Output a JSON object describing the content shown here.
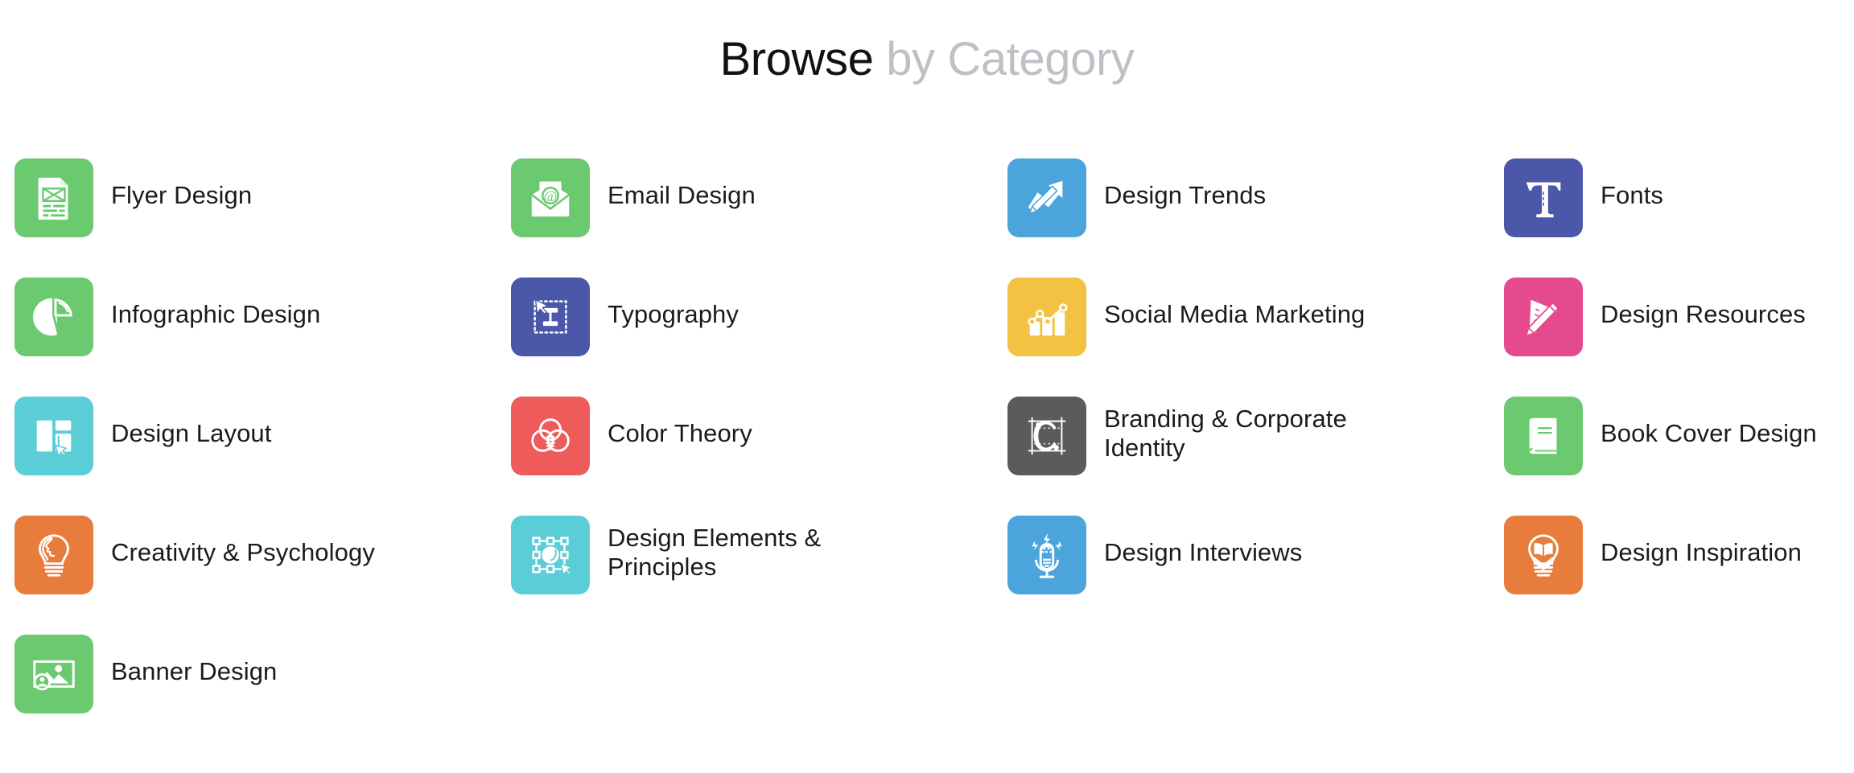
{
  "heading": {
    "strong": "Browse",
    "light": " by Category"
  },
  "colors": {
    "green": "#6BC96F",
    "blue": "#4BA5DC",
    "indigo": "#4B57A8",
    "amber": "#F3C243",
    "pink": "#E5498E",
    "cyan": "#5ACDD7",
    "red": "#EE5B5B",
    "darkgray": "#5B5B5B",
    "orange": "#E87C3C",
    "text_dark": "#1b1b1b",
    "text_light": "#bdc1c6",
    "background": "#ffffff"
  },
  "categories": [
    {
      "label": "Flyer Design",
      "icon": "flyer-document-icon",
      "color": "#6BC96F",
      "two_line": false
    },
    {
      "label": "Email Design",
      "icon": "envelope-at-icon",
      "color": "#6BC96F",
      "two_line": false
    },
    {
      "label": "Design Trends",
      "icon": "trend-arrow-pencil-icon",
      "color": "#4BA5DC",
      "two_line": false
    },
    {
      "label": "Fonts",
      "icon": "serif-t-icon",
      "color": "#4B57A8",
      "two_line": false
    },
    {
      "label": "Infographic Design",
      "icon": "pie-chart-icon",
      "color": "#6BC96F",
      "two_line": false
    },
    {
      "label": "Typography",
      "icon": "text-cursor-select-icon",
      "color": "#4B57A8",
      "two_line": false
    },
    {
      "label": "Social Media Marketing",
      "icon": "bar-chart-line-icon",
      "color": "#F3C243",
      "two_line": false
    },
    {
      "label": "Design Resources",
      "icon": "ruler-pencil-icon",
      "color": "#E5498E",
      "two_line": false
    },
    {
      "label": "Design Layout",
      "icon": "layout-blocks-icon",
      "color": "#5ACDD7",
      "two_line": false
    },
    {
      "label": "Color Theory",
      "icon": "venn-circles-icon",
      "color": "#EE5B5B",
      "two_line": false
    },
    {
      "label": "Branding & Corporate Identity",
      "icon": "letter-c-guides-icon",
      "color": "#5B5B5B",
      "two_line": true
    },
    {
      "label": "Book Cover Design",
      "icon": "book-icon",
      "color": "#6BC96F",
      "two_line": false
    },
    {
      "label": "Creativity & Psychology",
      "icon": "head-lightbulb-icon",
      "color": "#E87C3C",
      "two_line": false
    },
    {
      "label": "Design Elements & Principles",
      "icon": "selection-handles-icon",
      "color": "#5ACDD7",
      "two_line": true
    },
    {
      "label": "Design Interviews",
      "icon": "microphone-icon",
      "color": "#4BA5DC",
      "two_line": false
    },
    {
      "label": "Design Inspiration",
      "icon": "lightbulb-book-icon",
      "color": "#E87C3C",
      "two_line": false
    },
    {
      "label": "Banner Design",
      "icon": "image-banner-icon",
      "color": "#6BC96F",
      "two_line": false
    }
  ]
}
